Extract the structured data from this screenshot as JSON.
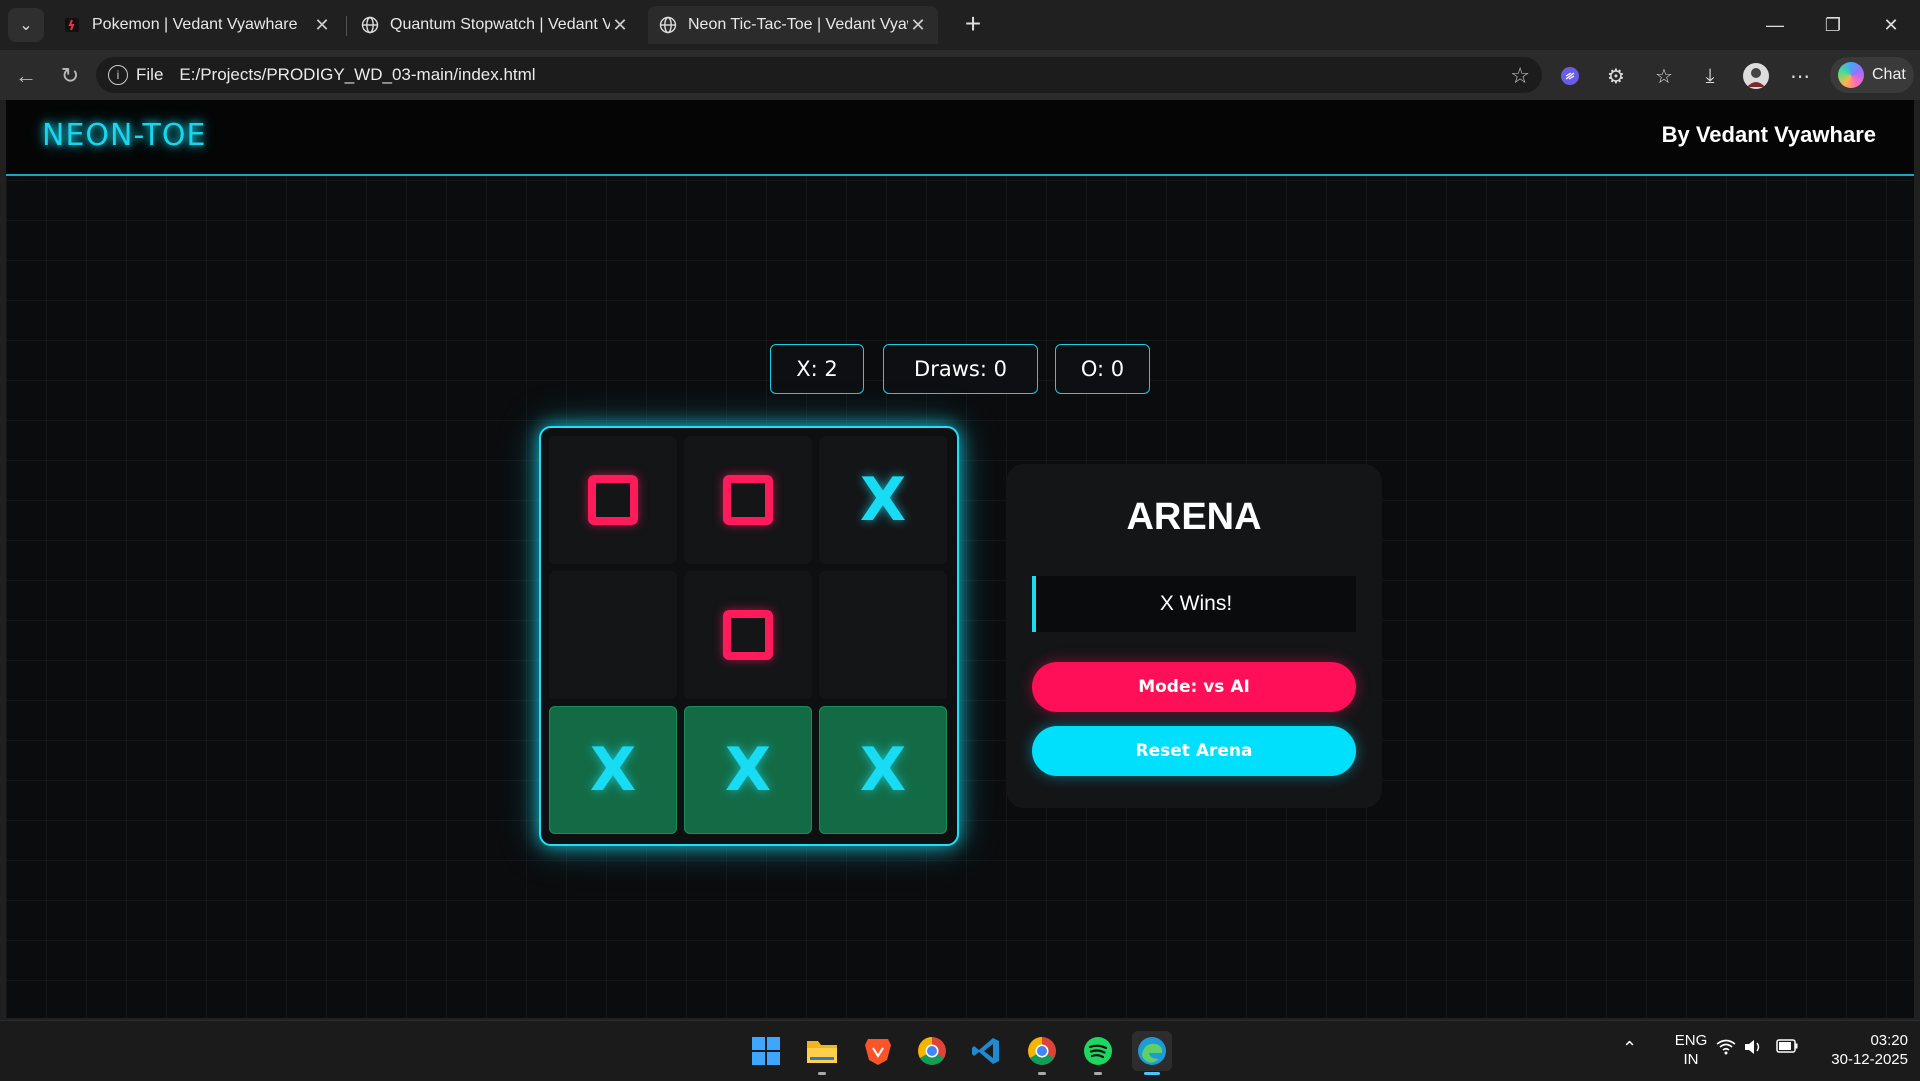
{
  "browser": {
    "tabs": [
      {
        "title": "Pokemon | Vedant Vyawhare",
        "favicon": "pokeball-icon",
        "active": false
      },
      {
        "title": "Quantum Stopwatch | Vedant Vyawhare",
        "favicon": "globe-icon",
        "active": false
      },
      {
        "title": "Neon Tic-Tac-Toe | Vedant Vyawhare",
        "favicon": "globe-icon",
        "active": true
      }
    ],
    "address": {
      "scheme": "File",
      "url": "E:/Projects/PRODIGY_WD_03-main/index.html"
    },
    "chat_label": "Chat"
  },
  "site": {
    "logo": "NEON-TOE",
    "byline": "By Vedant Vyawhare"
  },
  "scores": {
    "x": "X: 2",
    "draws": "Draws: 0",
    "o": "O: 0"
  },
  "board": {
    "cells": [
      "O",
      "O",
      "X",
      "",
      "O",
      "",
      "X",
      "X",
      "X"
    ],
    "winning_cells": [
      6,
      7,
      8
    ],
    "colors": {
      "x": "#17dcf3",
      "o": "#ff1a5c",
      "win": "#136b45"
    }
  },
  "panel": {
    "title": "ARENA",
    "status": "X Wins!",
    "mode_button": "Mode: vs AI",
    "reset_button": "Reset Arena"
  },
  "taskbar": {
    "apps": [
      "windows-start-icon",
      "file-explorer-icon",
      "brave-icon",
      "chrome-icon",
      "vscode-icon",
      "chrome-icon",
      "spotify-icon",
      "edge-icon"
    ],
    "language": "ENG",
    "region": "IN",
    "time": "03:20",
    "date": "30-12-2025"
  }
}
